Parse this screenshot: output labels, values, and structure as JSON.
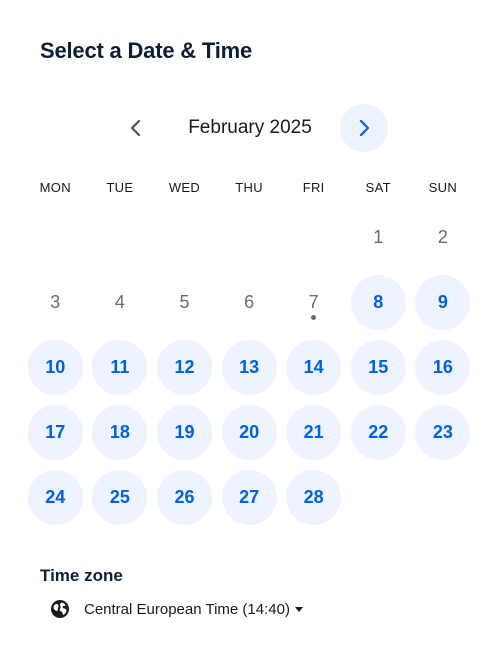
{
  "page": {
    "title": "Select a Date & Time"
  },
  "calendar": {
    "month_label": "February 2025",
    "weekdays": [
      "MON",
      "TUE",
      "WED",
      "THU",
      "FRI",
      "SAT",
      "SUN"
    ],
    "leading_blanks": 5,
    "days": [
      {
        "label": "1",
        "available": false,
        "today": false
      },
      {
        "label": "2",
        "available": false,
        "today": false
      },
      {
        "label": "3",
        "available": false,
        "today": false
      },
      {
        "label": "4",
        "available": false,
        "today": false
      },
      {
        "label": "5",
        "available": false,
        "today": false
      },
      {
        "label": "6",
        "available": false,
        "today": false
      },
      {
        "label": "7",
        "available": false,
        "today": true
      },
      {
        "label": "8",
        "available": true,
        "today": false
      },
      {
        "label": "9",
        "available": true,
        "today": false
      },
      {
        "label": "10",
        "available": true,
        "today": false
      },
      {
        "label": "11",
        "available": true,
        "today": false
      },
      {
        "label": "12",
        "available": true,
        "today": false
      },
      {
        "label": "13",
        "available": true,
        "today": false
      },
      {
        "label": "14",
        "available": true,
        "today": false
      },
      {
        "label": "15",
        "available": true,
        "today": false
      },
      {
        "label": "16",
        "available": true,
        "today": false
      },
      {
        "label": "17",
        "available": true,
        "today": false
      },
      {
        "label": "18",
        "available": true,
        "today": false
      },
      {
        "label": "19",
        "available": true,
        "today": false
      },
      {
        "label": "20",
        "available": true,
        "today": false
      },
      {
        "label": "21",
        "available": true,
        "today": false
      },
      {
        "label": "22",
        "available": true,
        "today": false
      },
      {
        "label": "23",
        "available": true,
        "today": false
      },
      {
        "label": "24",
        "available": true,
        "today": false
      },
      {
        "label": "25",
        "available": true,
        "today": false
      },
      {
        "label": "26",
        "available": true,
        "today": false
      },
      {
        "label": "27",
        "available": true,
        "today": false
      },
      {
        "label": "28",
        "available": true,
        "today": false
      }
    ],
    "prev_icon": "chevron-left-icon",
    "next_icon": "chevron-right-icon"
  },
  "timezone": {
    "heading": "Time zone",
    "value": "Central European Time (14:40)",
    "icon": "globe-icon"
  },
  "colors": {
    "accent": "#0060e6",
    "available_bg": "#edf3ff",
    "title": "#0b2036",
    "muted": "#6b6b6b"
  }
}
